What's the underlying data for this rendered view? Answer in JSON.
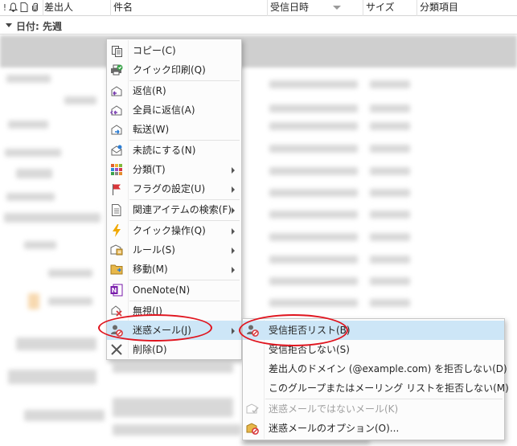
{
  "header": {
    "col_importance": "!",
    "col_reminder_icon": "bell-icon",
    "col_type_icon": "document-icon",
    "col_attach_icon": "paperclip-icon",
    "col_from": "差出人",
    "col_subject": "件名",
    "col_received": "受信日時",
    "col_size": "サイズ",
    "col_category": "分類項目"
  },
  "group": {
    "label": "日付: 先週"
  },
  "context_menu": {
    "items": [
      {
        "label": "コピー(C)",
        "icon": "copy-icon"
      },
      {
        "label": "クイック印刷(Q)",
        "icon": "print-icon"
      },
      {
        "label": "返信(R)",
        "icon": "reply-icon"
      },
      {
        "label": "全員に返信(A)",
        "icon": "reply-all-icon"
      },
      {
        "label": "転送(W)",
        "icon": "forward-icon"
      },
      {
        "label": "未読にする(N)",
        "icon": "mark-unread-icon"
      },
      {
        "label": "分類(T)",
        "icon": "categorize-icon"
      },
      {
        "label": "フラグの設定(U)",
        "icon": "flag-icon"
      },
      {
        "label": "関連アイテムの検索(F)",
        "icon": "find-related-icon"
      },
      {
        "label": "クイック操作(Q)",
        "icon": "quick-steps-icon"
      },
      {
        "label": "ルール(S)",
        "icon": "rules-icon"
      },
      {
        "label": "移動(M)",
        "icon": "move-folder-icon"
      },
      {
        "label": "OneNote(N)",
        "icon": "onenote-icon"
      },
      {
        "label": "無視(I)",
        "icon": "ignore-icon"
      },
      {
        "label": "迷惑メール(J)",
        "icon": "junk-icon"
      },
      {
        "label": "削除(D)",
        "icon": "delete-icon"
      }
    ]
  },
  "junk_submenu": {
    "items": [
      {
        "label": "受信拒否リスト(B)",
        "icon": "block-sender-icon",
        "state": "highlighted"
      },
      {
        "label": "受信拒否しない(S)",
        "icon": "",
        "state": "normal"
      },
      {
        "label": "差出人のドメイン (@example.com) を拒否しない(D)",
        "icon": "",
        "state": "normal"
      },
      {
        "label": "このグループまたはメーリング リストを拒否しない(M)",
        "icon": "",
        "state": "normal"
      },
      {
        "label": "迷惑メールではないメール(K)",
        "icon": "not-junk-icon",
        "state": "disabled"
      },
      {
        "label": "迷惑メールのオプション(O)...",
        "icon": "junk-options-icon",
        "state": "normal"
      }
    ]
  },
  "colors": {
    "highlight": "#cde6f7",
    "annotation_ring": "#e0141e",
    "flag": "#d8363a",
    "lightning": "#f0a800",
    "onenote": "#7719aa"
  }
}
